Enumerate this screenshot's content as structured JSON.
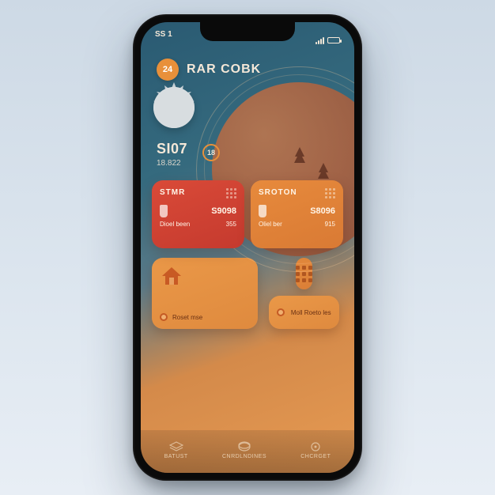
{
  "statusbar": {
    "time": "SS 1"
  },
  "hero": {
    "badge": "24",
    "title": "RAR COBK"
  },
  "mid": {
    "value": "SI07",
    "sub": "18.822",
    "chip": "18"
  },
  "cards": {
    "left": {
      "title": "STMR",
      "amount": "S9098",
      "label1": "Dioel been",
      "label2": "355"
    },
    "right": {
      "title": "SROTON",
      "amount": "S8096",
      "label1": "Oliel ber",
      "label2": "915"
    }
  },
  "tiles": {
    "left_label": "Roset mse",
    "small_label": "Moll Roeto les"
  },
  "tabs": {
    "t1": "BATUST",
    "t2": "Cnrdlndines",
    "t3": "CHCRGET"
  },
  "colors": {
    "accent": "#e8903a",
    "red": "#d94a38",
    "orange": "#e78a3c",
    "teal": "#2a5a72"
  }
}
